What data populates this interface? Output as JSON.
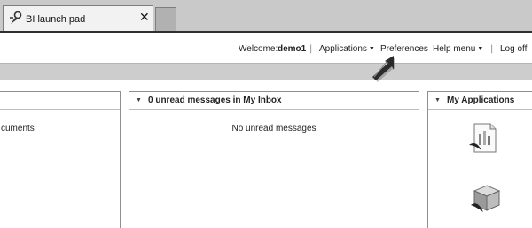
{
  "browser": {
    "tab_title": "BI launch pad",
    "tab_close": "✕"
  },
  "header": {
    "welcome_label": "Welcome:",
    "username": "demo1",
    "separator": "|",
    "menu": {
      "applications": "Applications",
      "preferences": "Preferences",
      "help_menu": "Help menu",
      "log_off": "Log off"
    }
  },
  "panels": {
    "left": {
      "content_text": "cuments"
    },
    "inbox": {
      "title": "0 unread messages in My Inbox",
      "content_text": "No unread messages"
    },
    "my_applications": {
      "title": "My Applications"
    }
  },
  "icons": {
    "tab_icon": "bi-launchpad-icon",
    "dropdown_caret": "caret-down-icon",
    "collapse": "collapse-triangle-icon",
    "pointer": "pointer-arrow-icon",
    "app1": "document-app-icon",
    "app2": "cube-app-icon"
  }
}
